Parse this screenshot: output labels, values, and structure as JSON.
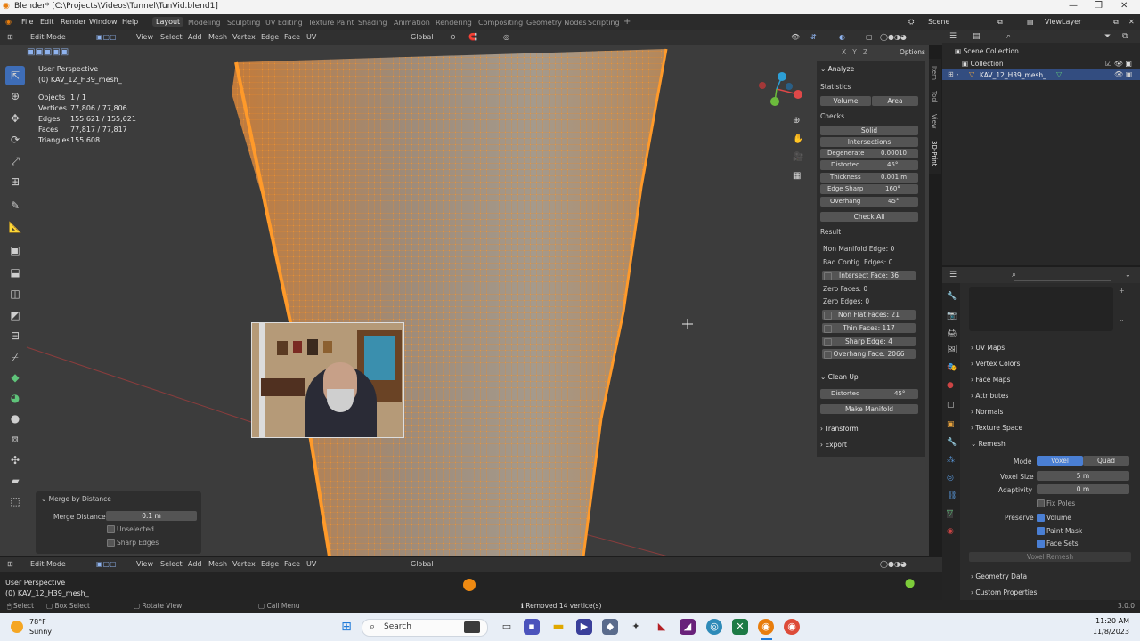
{
  "window": {
    "title": "Blender* [C:\\Projects\\Videos\\Tunnel\\TunVid.blend1]"
  },
  "menu": [
    "File",
    "Edit",
    "Render",
    "Window",
    "Help"
  ],
  "workspaces": [
    "Layout",
    "Modeling",
    "Sculpting",
    "UV Editing",
    "Texture Paint",
    "Shading",
    "Animation",
    "Rendering",
    "Compositing",
    "Geometry Nodes",
    "Scripting"
  ],
  "scene": {
    "label": "Scene",
    "view_layer": "ViewLayer"
  },
  "viewport_header": {
    "mode": "Edit Mode",
    "menus": [
      "View",
      "Select",
      "Add",
      "Mesh",
      "Vertex",
      "Edge",
      "Face",
      "UV"
    ],
    "orientation": "Global",
    "options": "Options"
  },
  "viewport": {
    "perspective": "User Perspective",
    "object": "(0) KAV_12_H39_mesh_",
    "stats": [
      {
        "label": "Objects",
        "value": "1 / 1"
      },
      {
        "label": "Vertices",
        "value": "77,806 / 77,806"
      },
      {
        "label": "Edges",
        "value": "155,621 / 155,621"
      },
      {
        "label": "Faces",
        "value": "77,817 / 77,817"
      },
      {
        "label": "Triangles",
        "value": "155,608"
      }
    ],
    "gizmo": {
      "x": "X",
      "y": "Y",
      "z": "Z"
    }
  },
  "print3d": {
    "tabs": [
      "Item",
      "Tool",
      "View",
      "3D-Print"
    ],
    "analyze": "Analyze",
    "statistics": "Statistics",
    "volume": "Volume",
    "area": "Area",
    "checks": "Checks",
    "solid": "Solid",
    "intersections": "Intersections",
    "check_fields": [
      {
        "label": "Degenerate",
        "value": "0.00010"
      },
      {
        "label": "Distorted",
        "value": "45°"
      },
      {
        "label": "Thickness",
        "value": "0.001 m"
      },
      {
        "label": "Edge Sharp",
        "value": "160°"
      },
      {
        "label": "Overhang",
        "value": "45°"
      }
    ],
    "check_all": "Check All",
    "result": "Result",
    "results": [
      {
        "text": "Non Manifold Edge: 0",
        "button": false
      },
      {
        "text": "Bad Contig. Edges: 0",
        "button": false
      },
      {
        "text": "Intersect Face: 36",
        "button": true
      },
      {
        "text": "Zero Faces: 0",
        "button": false
      },
      {
        "text": "Zero Edges: 0",
        "button": false
      },
      {
        "text": "Non Flat Faces: 21",
        "button": true
      },
      {
        "text": "Thin Faces: 117",
        "button": true
      },
      {
        "text": "Sharp Edge: 4",
        "button": true
      },
      {
        "text": "Overhang Face: 2066",
        "button": true
      }
    ],
    "cleanup": "Clean Up",
    "cleanup_distorted": {
      "label": "Distorted",
      "value": "45°"
    },
    "make_manifold": "Make Manifold",
    "transform": "Transform",
    "export": "Export"
  },
  "operator_panel": {
    "title": "Merge by Distance",
    "merge_distance_label": "Merge Distance",
    "merge_distance_value": "0.1 m",
    "unselected": "Unselected",
    "sharp_edges": "Sharp Edges"
  },
  "outliner": {
    "scene_collection": "Scene Collection",
    "collection": "Collection",
    "object": "KAV_12_H39_mesh_"
  },
  "properties": {
    "sections": [
      "UV Maps",
      "Vertex Colors",
      "Face Maps",
      "Attributes",
      "Normals",
      "Texture Space",
      "Remesh"
    ],
    "mode_label": "Mode",
    "mode_voxel": "Voxel",
    "mode_quad": "Quad",
    "voxel_size_label": "Voxel Size",
    "voxel_size": "5 m",
    "adaptivity_label": "Adaptivity",
    "adaptivity": "0 m",
    "fix_poles": "Fix Poles",
    "preserve_label": "Preserve",
    "volume": "Volume",
    "paint_mask": "Paint Mask",
    "face_sets": "Face Sets",
    "voxel_remesh": "Voxel Remesh",
    "geometry_data": "Geometry Data",
    "custom_properties": "Custom Properties"
  },
  "timeline": {
    "mode": "Edit Mode",
    "perspective": "User Perspective",
    "object": "(0) KAV_12_H39_mesh_"
  },
  "status": {
    "select": "Select",
    "box_select": "Box Select",
    "rotate": "Rotate View",
    "call_menu": "Call Menu",
    "message": "Removed 14 vertice(s)",
    "version": "3.0.0"
  },
  "taskbar": {
    "weather_temp": "78°F",
    "weather_text": "Sunny",
    "search": "Search",
    "time": "11:20 AM",
    "date": "11/8/2023"
  },
  "colors": {
    "accent": "#4a7fd4",
    "mesh": "#f0922a",
    "viewport": "#3c3c3c",
    "panel": "#2c2c2c"
  }
}
